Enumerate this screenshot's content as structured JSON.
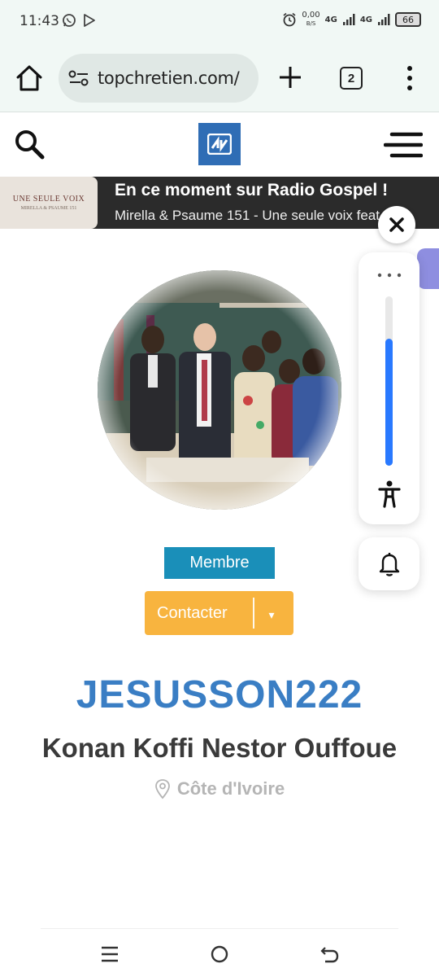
{
  "status_bar": {
    "time": "11:43",
    "net_speed_value": "0,00",
    "net_speed_unit": "B/S",
    "signal_1": "4G",
    "signal_2": "4G",
    "battery": "66"
  },
  "browser": {
    "url": "topchretien.com/",
    "tab_count": "2"
  },
  "radio": {
    "title": "En ce moment sur Radio Gospel !",
    "now_playing": "Mirella & Psaume 151 - Une seule voix feat....",
    "thumb_title": "UNE SEULE VOIX",
    "thumb_subtitle": "MIRELLA & PSAUME 151"
  },
  "accessibility_panel": {
    "slider_level": 0.75
  },
  "profile": {
    "role_badge": "Membre",
    "contact_label": "Contacter",
    "contact_caret": "▾",
    "username": "JESUSSON222",
    "full_name": "Konan Koffi Nestor Ouffoue",
    "location": "Côte d'Ivoire"
  },
  "colors": {
    "brand_blue": "#2f6db5",
    "username_blue": "#3a7ec4",
    "badge_blue": "#1a8fb9",
    "contact_orange": "#f8b43f",
    "slider_blue": "#2979ff"
  },
  "icons": [
    "whatsapp-icon",
    "play-store-icon",
    "alarm-icon",
    "home-icon",
    "site-settings-icon",
    "plus-icon",
    "more-vert-icon",
    "search-icon",
    "hamburger-icon",
    "close-icon",
    "accessibility-icon",
    "bell-icon",
    "location-pin-icon",
    "recents-icon",
    "home-circle-icon",
    "back-icon"
  ]
}
